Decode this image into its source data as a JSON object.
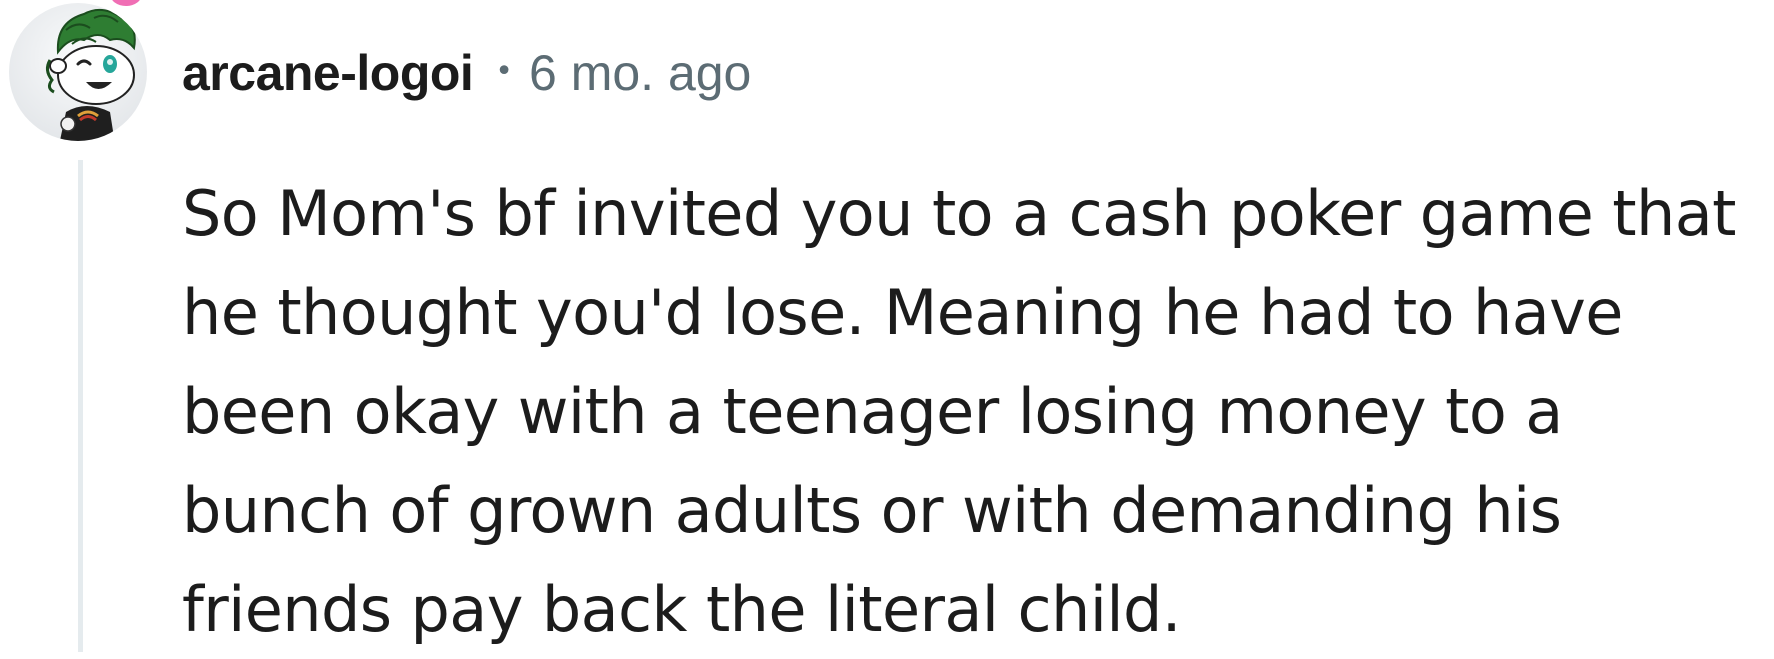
{
  "comment": {
    "author": "arcane-logoi",
    "separator": "•",
    "timestamp": "6 mo. ago",
    "body": "So Mom's bf invited you to a cash poker game that he thought you'd lose. Meaning he had to have been okay with a teenager losing money to a bunch of grown adults or with demanding his friends pay back the literal child."
  },
  "colors": {
    "text": "#1c1c1c",
    "meta": "#5c6c74",
    "thread_line": "#e5ebee",
    "avatar_hair": "#2e7d32",
    "avatar_balloon": "#f06eb4"
  },
  "icons": {
    "avatar": "snoo-avatar-icon"
  }
}
